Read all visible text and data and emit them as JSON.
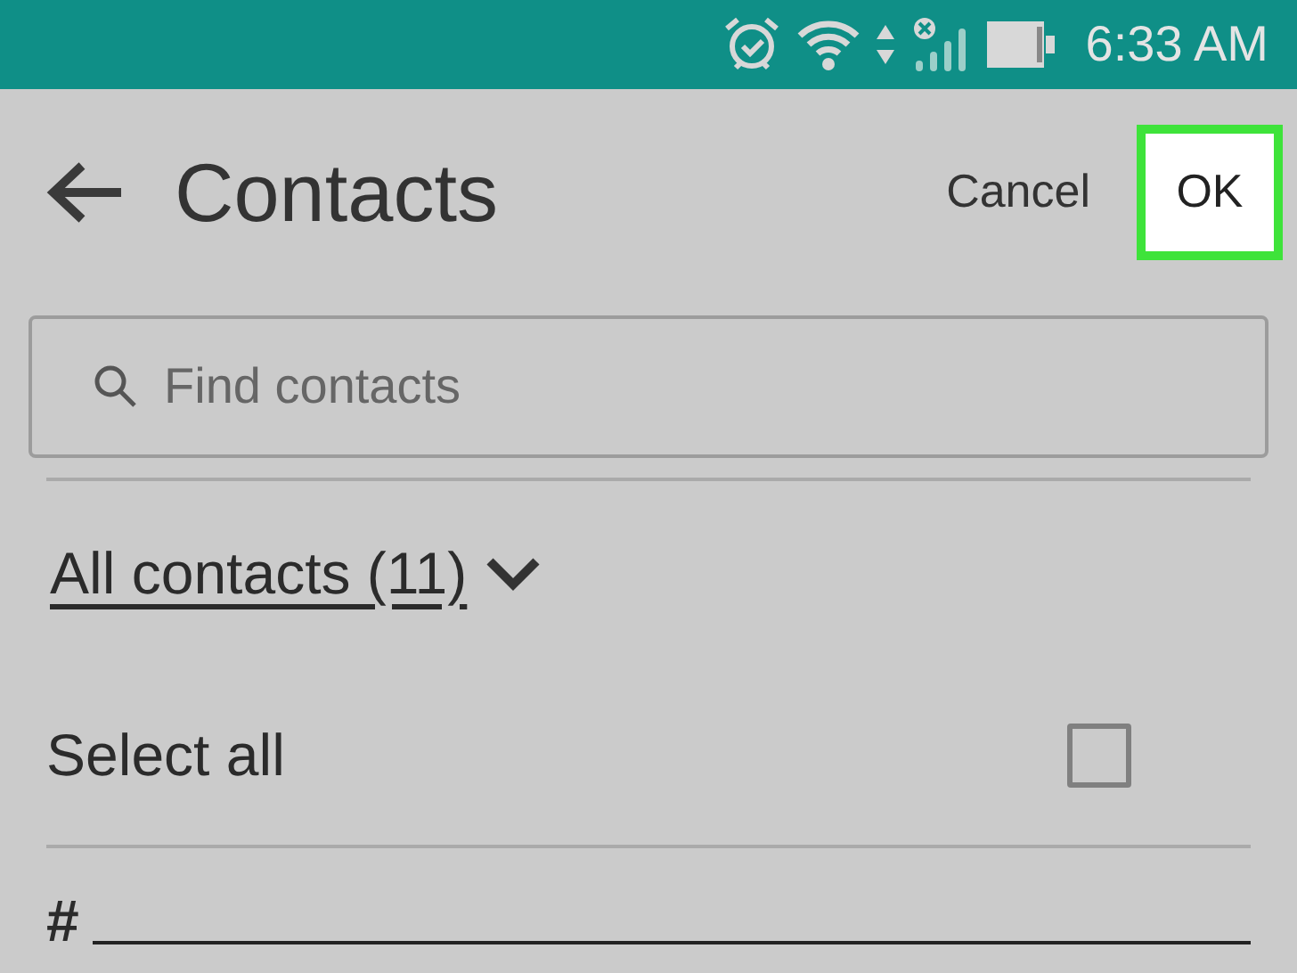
{
  "status_bar": {
    "time": "6:33 AM"
  },
  "header": {
    "title": "Contacts",
    "cancel": "Cancel",
    "ok": {
      "label": "OK",
      "highlighted": true
    }
  },
  "search": {
    "placeholder": "Find contacts"
  },
  "filter": {
    "label": "All contacts (11)"
  },
  "select_all": {
    "label": "Select all",
    "checked": false
  },
  "sections": [
    {
      "label": "#"
    }
  ]
}
